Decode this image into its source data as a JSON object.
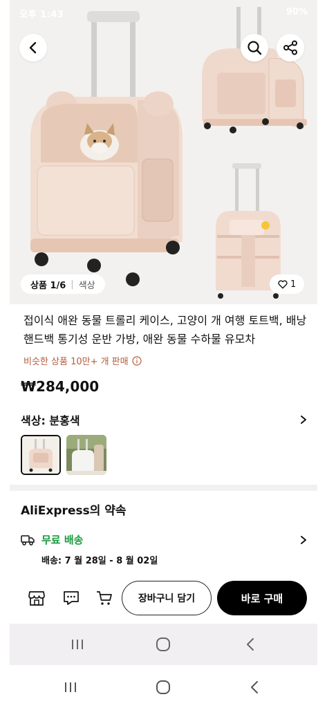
{
  "status_bar": {
    "left_text": "오후 1:43",
    "right_text": "90%"
  },
  "gallery": {
    "counter": "상품 1/6",
    "variant_label": "색상",
    "like_count": "1"
  },
  "product": {
    "title": "접이식 애완 동물 트롤리 케이스, 고양이 개 여행 토트백, 배낭 핸드백 통기성 운반 가방, 애완 동물 수하물 유모차",
    "sold_text": "비슷한 상품 10만+ 개 판매",
    "price": "₩284,000"
  },
  "color_selector": {
    "label": "색상: 분홍색"
  },
  "promise": {
    "title": "AliExpress의 약속",
    "shipping_label": "무료 배송",
    "shipping_date": "배송: 7 월 28일 - 8 월 02일"
  },
  "actions": {
    "add_to_cart": "장바구니 담기",
    "buy_now": "바로 구매"
  },
  "icons": {
    "back": "chevron-left-icon",
    "search": "search-icon",
    "share": "share-icon",
    "heart": "heart-icon",
    "info": "info-icon",
    "truck": "truck-icon",
    "store": "store-icon",
    "chat": "chat-icon",
    "cart": "cart-icon"
  },
  "colors": {
    "accent_green": "#1a9a3c",
    "sold_brown": "#b45a3c",
    "bag_pink": "#f0d8ca"
  }
}
